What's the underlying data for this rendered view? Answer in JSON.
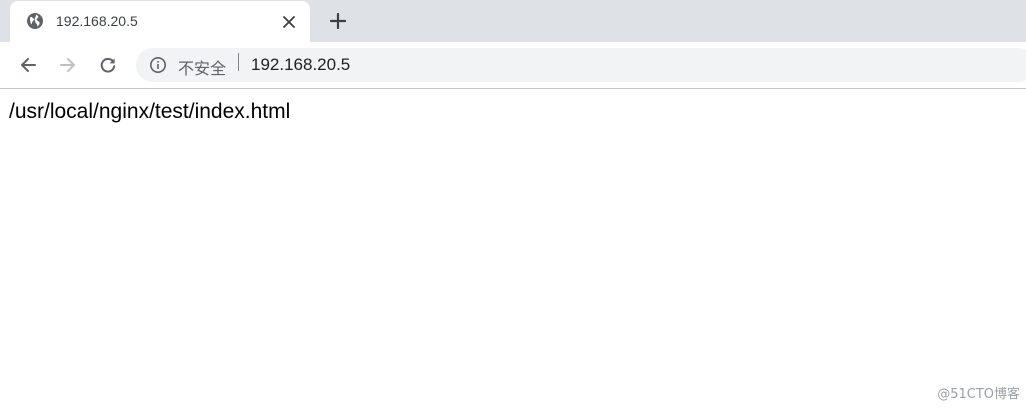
{
  "tab": {
    "title": "192.168.20.5",
    "favicon": "globe-icon"
  },
  "toolbar": {
    "back_icon": "back-arrow-icon",
    "forward_icon": "forward-arrow-icon",
    "reload_icon": "reload-icon",
    "security_icon": "info-icon",
    "security_label": "不安全",
    "url": "192.168.20.5"
  },
  "page": {
    "text": "/usr/local/nginx/test/index.html"
  },
  "watermark": "@51CTO博客",
  "colors": {
    "tabstrip": "#dee1e6",
    "omnibox": "#f1f3f4",
    "icon": "#5f6368",
    "icon_disabled": "#bdc1c6"
  }
}
